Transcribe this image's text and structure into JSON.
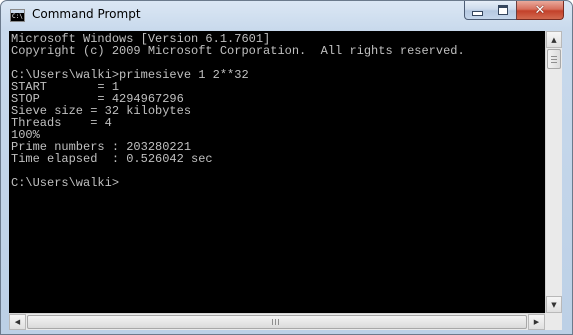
{
  "window": {
    "title": "Command Prompt",
    "icon": "cmd-icon",
    "icon_text": "C:\\"
  },
  "controls": {
    "minimize_icon": "minimize-icon",
    "maximize_icon": "maximize-icon",
    "close_icon": "close-icon",
    "close_glyph": "✕"
  },
  "console": {
    "lines": [
      "Microsoft Windows [Version 6.1.7601]",
      "Copyright (c) 2009 Microsoft Corporation.  All rights reserved.",
      "",
      "C:\\Users\\walki>primesieve 1 2**32",
      "START       = 1",
      "STOP        = 4294967296",
      "Sieve size = 32 kilobytes",
      "Threads    = 4",
      "100%",
      "Prime numbers : 203280221",
      "Time elapsed  : 0.526042 sec",
      "",
      "C:\\Users\\walki>"
    ],
    "text_color": "#c0c0c0",
    "background_color": "#000000"
  },
  "scrollbars": {
    "up_arrow": "▲",
    "down_arrow": "▼",
    "left_arrow": "◀",
    "right_arrow": "▶"
  }
}
